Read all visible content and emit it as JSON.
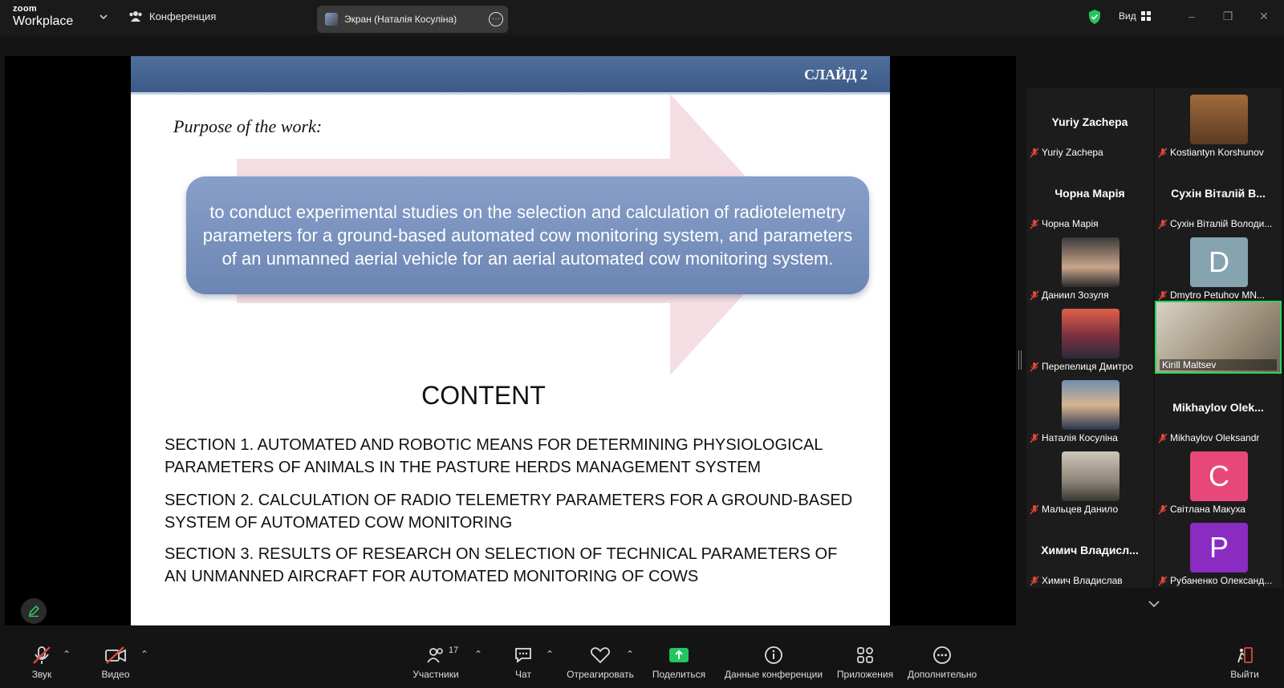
{
  "titlebar": {
    "logo_top": "zoom",
    "logo_bottom": "Workplace",
    "conference_label": "Конференция",
    "screen_tab_label": "Экран (Наталія Косуліна)",
    "view_label": "Вид"
  },
  "slide": {
    "number": "СЛАЙД 2",
    "purpose_heading": "Purpose of the work:",
    "goal_text": "to conduct experimental studies on the selection and calculation of radiotelemetry parameters for a ground-based automated cow monitoring system, and parameters of an unmanned aerial vehicle for an aerial automated cow monitoring system.",
    "content_title": "CONTENT",
    "sections": [
      "SECTION 1. AUTOMATED AND ROBOTIC MEANS FOR DETERMINING PHYSIOLOGICAL PARAMETERS OF ANIMALS IN THE PASTURE HERDS MANAGEMENT SYSTEM",
      "SECTION 2. CALCULATION OF RADIO TELEMETRY PARAMETERS FOR A GROUND-BASED SYSTEM OF AUTOMATED COW MONITORING",
      "SECTION 3. RESULTS OF RESEARCH ON SELECTION OF TECHNICAL PARAMETERS OF AN UNMANNED AIRCRAFT FOR AUTOMATED MONITORING OF COWS"
    ]
  },
  "participants": [
    {
      "big": "Yuriy Zachepa",
      "label": "Yuriy Zachepa"
    },
    {
      "big": "",
      "label": "Kostiantyn Korshunov"
    },
    {
      "big": "Чорна Марія",
      "label": "Чорна Марія"
    },
    {
      "big": "Сухін Віталій В...",
      "label": "Сухін Віталій Володи..."
    },
    {
      "big": "",
      "label": "Даниил Зозуля"
    },
    {
      "big": "D",
      "label": "Dmytro Petuhov MN..."
    },
    {
      "big": "",
      "label": "Перепелиця Дмитро"
    },
    {
      "big": "",
      "label": "Kirill Maltsev"
    },
    {
      "big": "",
      "label": "Наталія Косуліна"
    },
    {
      "big": "Mikhaylov  Olek...",
      "label": "Mikhaylov Oleksandr"
    },
    {
      "big": "",
      "label": "Мальцев Данило"
    },
    {
      "big": "C",
      "label": "Світлана Макуха"
    },
    {
      "big": "Химич  Владисл...",
      "label": "Химич Владислав"
    },
    {
      "big": "P",
      "label": "Рубаненко Олександ..."
    }
  ],
  "colors": {
    "avatar_d": "#86a3b0",
    "avatar_c": "#e8477a",
    "avatar_p": "#8a2bc2",
    "active_border": "#2bd45e",
    "share_green": "#22c55e",
    "muted_red": "#e0463a"
  },
  "toolbar": {
    "audio": "Звук",
    "video": "Видео",
    "participants": "Участники",
    "participants_count": "17",
    "chat": "Чат",
    "react": "Отреагировать",
    "share": "Поделиться",
    "info": "Данные конференции",
    "apps": "Приложения",
    "more": "Дополнительно",
    "leave": "Выйти"
  }
}
